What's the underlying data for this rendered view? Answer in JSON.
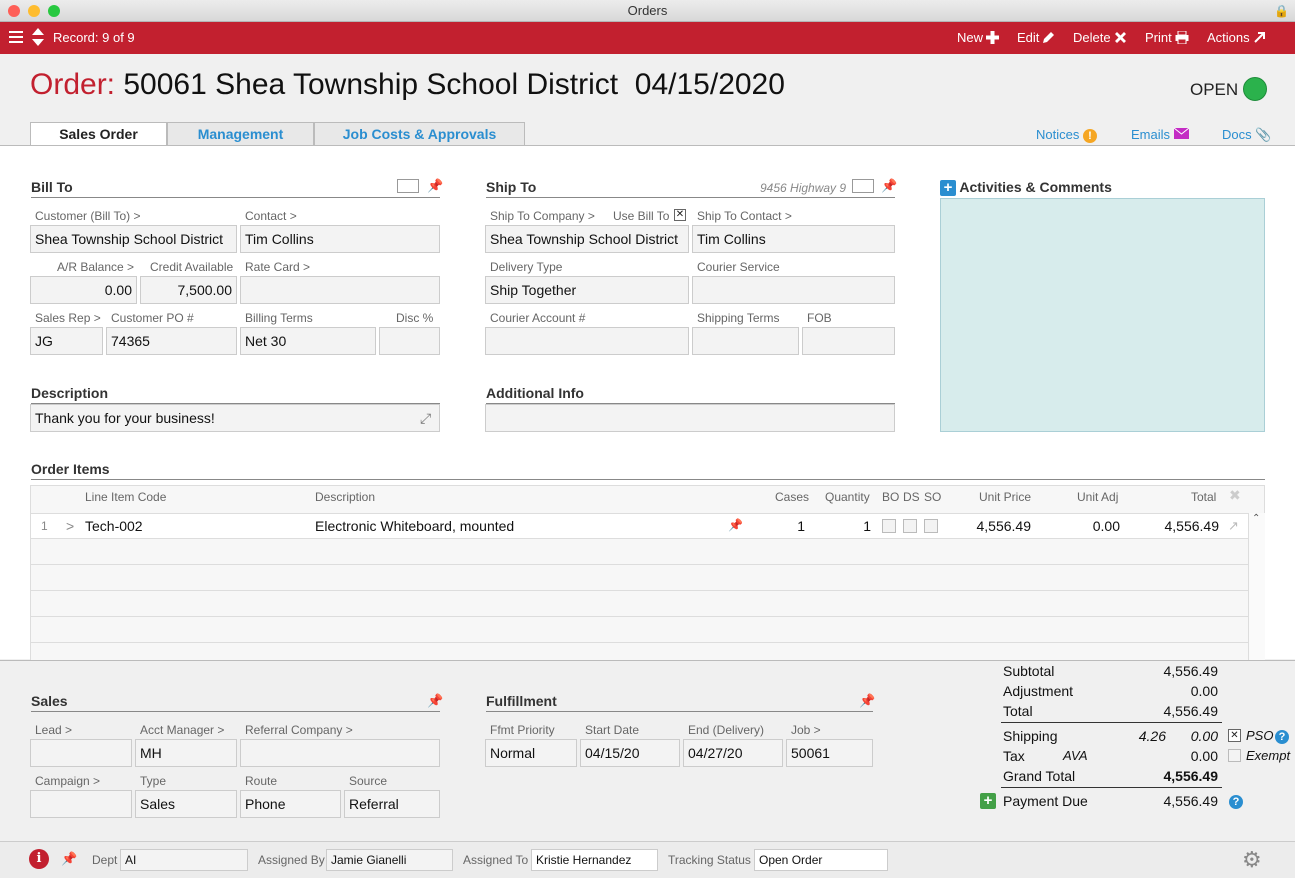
{
  "window": {
    "title": "Orders"
  },
  "toolbar": {
    "record": "Record: 9 of 9",
    "new": "New",
    "edit": "Edit",
    "delete": "Delete",
    "print": "Print",
    "actions": "Actions"
  },
  "order": {
    "prefix": "Order:",
    "title": "50061 Shea Township School District  04/15/2020",
    "status": "OPEN",
    "status_color": "#2bb24c"
  },
  "tabs": [
    "Sales Order",
    "Management",
    "Job Costs & Approvals"
  ],
  "links": {
    "notices": "Notices",
    "emails": "Emails",
    "docs": "Docs"
  },
  "bill_to": {
    "title": "Bill To",
    "customer_label": "Customer (Bill To) >",
    "customer": "Shea Township School District",
    "contact_label": "Contact >",
    "contact": "Tim Collins",
    "ar_label": "A/R Balance >",
    "ar": "0.00",
    "credit_label": "Credit Available",
    "credit": "7,500.00",
    "rate_label": "Rate Card >",
    "rate": "",
    "rep_label": "Sales Rep >",
    "rep": "JG",
    "po_label": "Customer PO #",
    "po": "74365",
    "terms_label": "Billing Terms",
    "terms": "Net 30",
    "disc_label": "Disc %",
    "disc": ""
  },
  "ship_to": {
    "title": "Ship To",
    "address_hint": "9456 Highway 9",
    "company_label": "Ship To Company >",
    "use_bill_label": "Use Bill To",
    "company": "Shea Township School District",
    "contact_label": "Ship To Contact >",
    "contact": "Tim Collins",
    "delivery_label": "Delivery Type",
    "delivery": "Ship Together",
    "courier_label": "Courier Service",
    "courier": "",
    "courier_acct_label": "Courier Account #",
    "courier_acct": "",
    "ship_terms_label": "Shipping Terms",
    "ship_terms": "",
    "fob_label": "FOB",
    "fob": ""
  },
  "activities": {
    "title": "Activities & Comments"
  },
  "description": {
    "title": "Description",
    "value": "Thank you for your business!"
  },
  "additional": {
    "title": "Additional Info",
    "value": ""
  },
  "items": {
    "title": "Order Items",
    "headers": {
      "code": "Line Item Code",
      "desc": "Description",
      "cases": "Cases",
      "qty": "Quantity",
      "bo": "BO",
      "ds": "DS",
      "so": "SO",
      "price": "Unit Price",
      "adj": "Unit Adj",
      "total": "Total"
    },
    "rows": [
      {
        "num": "1",
        "code": "Tech-002",
        "desc": "Electronic Whiteboard, mounted",
        "cases": "1",
        "qty": "1",
        "price": "4,556.49",
        "adj": "0.00",
        "total": "4,556.49"
      }
    ]
  },
  "sales": {
    "title": "Sales",
    "lead_label": "Lead >",
    "lead": "",
    "acct_label": "Acct Manager >",
    "acct": "MH",
    "ref_label": "Referral Company >",
    "ref": "",
    "camp_label": "Campaign >",
    "camp": "",
    "type_label": "Type",
    "type": "Sales",
    "route_label": "Route",
    "route": "Phone",
    "source_label": "Source",
    "source": "Referral"
  },
  "fulfillment": {
    "title": "Fulfillment",
    "prio_label": "Ffmt Priority",
    "prio": "Normal",
    "start_label": "Start Date",
    "start": "04/15/20",
    "end_label": "End (Delivery)",
    "end": "04/27/20",
    "job_label": "Job >",
    "job": "50061"
  },
  "totals": {
    "subtotal_label": "Subtotal",
    "subtotal": "4,556.49",
    "adj_label": "Adjustment",
    "adj": "0.00",
    "total_label": "Total",
    "total": "4,556.49",
    "ship_label": "Shipping",
    "ship_est": "4.26",
    "ship": "0.00",
    "pso": "PSO",
    "tax_label": "Tax",
    "tax_code": "AVA",
    "tax": "0.00",
    "exempt": "Exempt",
    "grand_label": "Grand Total",
    "grand": "4,556.49",
    "due_label": "Payment Due",
    "due": "4,556.49"
  },
  "footer": {
    "dept_label": "Dept",
    "dept": "AI",
    "assigned_by_label": "Assigned By",
    "assigned_by": "Jamie Gianelli",
    "assigned_to_label": "Assigned To",
    "assigned_to": "Kristie Hernandez",
    "tracking_label": "Tracking Status",
    "tracking": "Open Order"
  }
}
